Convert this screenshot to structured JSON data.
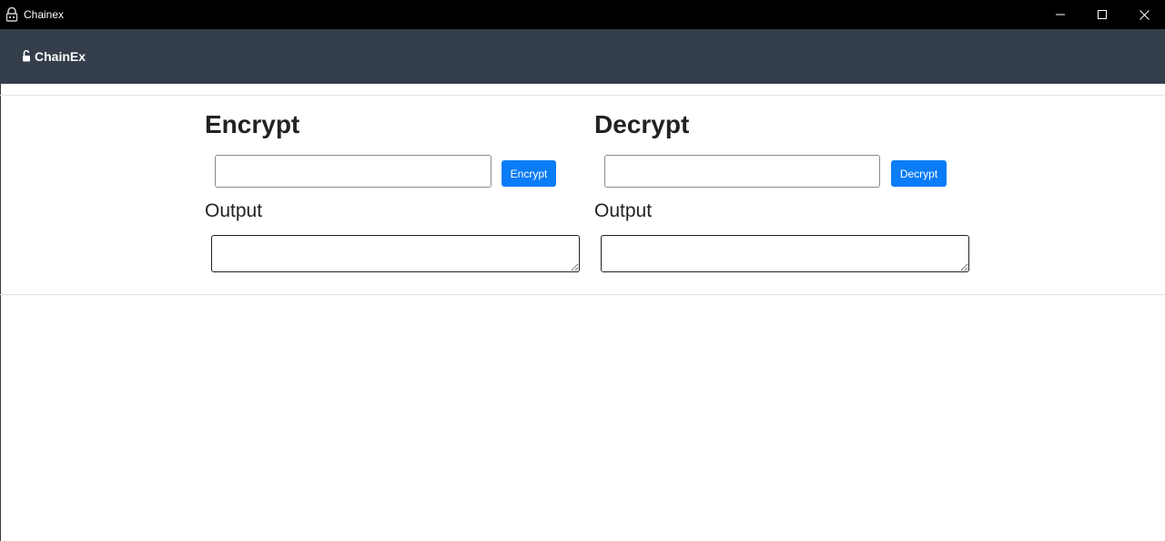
{
  "window": {
    "title": "Chainex",
    "ghost_text": "........ ...... ........ ........ ......"
  },
  "navbar": {
    "brand": "ChainEx"
  },
  "encrypt": {
    "heading": "Encrypt",
    "input_value": "",
    "button_label": "Encrypt",
    "output_heading": "Output",
    "output_value": ""
  },
  "decrypt": {
    "heading": "Decrypt",
    "input_value": "",
    "button_label": "Decrypt",
    "output_heading": "Output",
    "output_value": ""
  },
  "colors": {
    "titlebar": "#000000",
    "navbar": "#343f4b",
    "primary_button": "#0a7cf5"
  },
  "icons": {
    "app": "padlock-icon",
    "brand": "unlocked-padlock-icon",
    "minimize": "minimize-icon",
    "maximize": "maximize-icon",
    "close": "close-icon"
  }
}
